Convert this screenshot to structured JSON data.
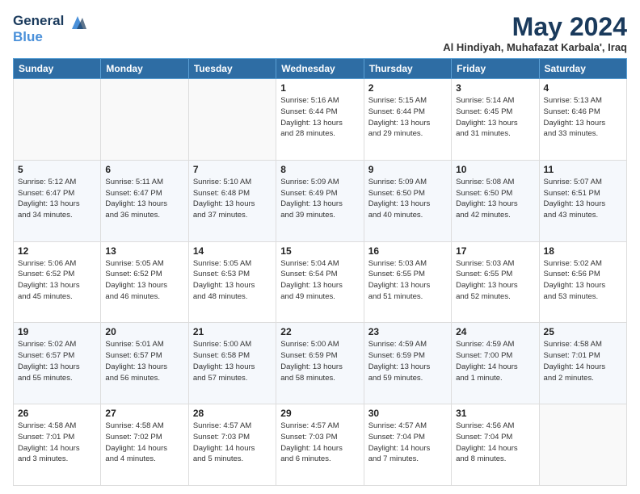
{
  "header": {
    "logo_line1": "General",
    "logo_line2": "Blue",
    "month": "May 2024",
    "location": "Al Hindiyah, Muhafazat Karbala', Iraq"
  },
  "weekdays": [
    "Sunday",
    "Monday",
    "Tuesday",
    "Wednesday",
    "Thursday",
    "Friday",
    "Saturday"
  ],
  "weeks": [
    [
      {
        "day": "",
        "info": ""
      },
      {
        "day": "",
        "info": ""
      },
      {
        "day": "",
        "info": ""
      },
      {
        "day": "1",
        "info": "Sunrise: 5:16 AM\nSunset: 6:44 PM\nDaylight: 13 hours\nand 28 minutes."
      },
      {
        "day": "2",
        "info": "Sunrise: 5:15 AM\nSunset: 6:44 PM\nDaylight: 13 hours\nand 29 minutes."
      },
      {
        "day": "3",
        "info": "Sunrise: 5:14 AM\nSunset: 6:45 PM\nDaylight: 13 hours\nand 31 minutes."
      },
      {
        "day": "4",
        "info": "Sunrise: 5:13 AM\nSunset: 6:46 PM\nDaylight: 13 hours\nand 33 minutes."
      }
    ],
    [
      {
        "day": "5",
        "info": "Sunrise: 5:12 AM\nSunset: 6:47 PM\nDaylight: 13 hours\nand 34 minutes."
      },
      {
        "day": "6",
        "info": "Sunrise: 5:11 AM\nSunset: 6:47 PM\nDaylight: 13 hours\nand 36 minutes."
      },
      {
        "day": "7",
        "info": "Sunrise: 5:10 AM\nSunset: 6:48 PM\nDaylight: 13 hours\nand 37 minutes."
      },
      {
        "day": "8",
        "info": "Sunrise: 5:09 AM\nSunset: 6:49 PM\nDaylight: 13 hours\nand 39 minutes."
      },
      {
        "day": "9",
        "info": "Sunrise: 5:09 AM\nSunset: 6:50 PM\nDaylight: 13 hours\nand 40 minutes."
      },
      {
        "day": "10",
        "info": "Sunrise: 5:08 AM\nSunset: 6:50 PM\nDaylight: 13 hours\nand 42 minutes."
      },
      {
        "day": "11",
        "info": "Sunrise: 5:07 AM\nSunset: 6:51 PM\nDaylight: 13 hours\nand 43 minutes."
      }
    ],
    [
      {
        "day": "12",
        "info": "Sunrise: 5:06 AM\nSunset: 6:52 PM\nDaylight: 13 hours\nand 45 minutes."
      },
      {
        "day": "13",
        "info": "Sunrise: 5:05 AM\nSunset: 6:52 PM\nDaylight: 13 hours\nand 46 minutes."
      },
      {
        "day": "14",
        "info": "Sunrise: 5:05 AM\nSunset: 6:53 PM\nDaylight: 13 hours\nand 48 minutes."
      },
      {
        "day": "15",
        "info": "Sunrise: 5:04 AM\nSunset: 6:54 PM\nDaylight: 13 hours\nand 49 minutes."
      },
      {
        "day": "16",
        "info": "Sunrise: 5:03 AM\nSunset: 6:55 PM\nDaylight: 13 hours\nand 51 minutes."
      },
      {
        "day": "17",
        "info": "Sunrise: 5:03 AM\nSunset: 6:55 PM\nDaylight: 13 hours\nand 52 minutes."
      },
      {
        "day": "18",
        "info": "Sunrise: 5:02 AM\nSunset: 6:56 PM\nDaylight: 13 hours\nand 53 minutes."
      }
    ],
    [
      {
        "day": "19",
        "info": "Sunrise: 5:02 AM\nSunset: 6:57 PM\nDaylight: 13 hours\nand 55 minutes."
      },
      {
        "day": "20",
        "info": "Sunrise: 5:01 AM\nSunset: 6:57 PM\nDaylight: 13 hours\nand 56 minutes."
      },
      {
        "day": "21",
        "info": "Sunrise: 5:00 AM\nSunset: 6:58 PM\nDaylight: 13 hours\nand 57 minutes."
      },
      {
        "day": "22",
        "info": "Sunrise: 5:00 AM\nSunset: 6:59 PM\nDaylight: 13 hours\nand 58 minutes."
      },
      {
        "day": "23",
        "info": "Sunrise: 4:59 AM\nSunset: 6:59 PM\nDaylight: 13 hours\nand 59 minutes."
      },
      {
        "day": "24",
        "info": "Sunrise: 4:59 AM\nSunset: 7:00 PM\nDaylight: 14 hours\nand 1 minute."
      },
      {
        "day": "25",
        "info": "Sunrise: 4:58 AM\nSunset: 7:01 PM\nDaylight: 14 hours\nand 2 minutes."
      }
    ],
    [
      {
        "day": "26",
        "info": "Sunrise: 4:58 AM\nSunset: 7:01 PM\nDaylight: 14 hours\nand 3 minutes."
      },
      {
        "day": "27",
        "info": "Sunrise: 4:58 AM\nSunset: 7:02 PM\nDaylight: 14 hours\nand 4 minutes."
      },
      {
        "day": "28",
        "info": "Sunrise: 4:57 AM\nSunset: 7:03 PM\nDaylight: 14 hours\nand 5 minutes."
      },
      {
        "day": "29",
        "info": "Sunrise: 4:57 AM\nSunset: 7:03 PM\nDaylight: 14 hours\nand 6 minutes."
      },
      {
        "day": "30",
        "info": "Sunrise: 4:57 AM\nSunset: 7:04 PM\nDaylight: 14 hours\nand 7 minutes."
      },
      {
        "day": "31",
        "info": "Sunrise: 4:56 AM\nSunset: 7:04 PM\nDaylight: 14 hours\nand 8 minutes."
      },
      {
        "day": "",
        "info": ""
      }
    ]
  ]
}
